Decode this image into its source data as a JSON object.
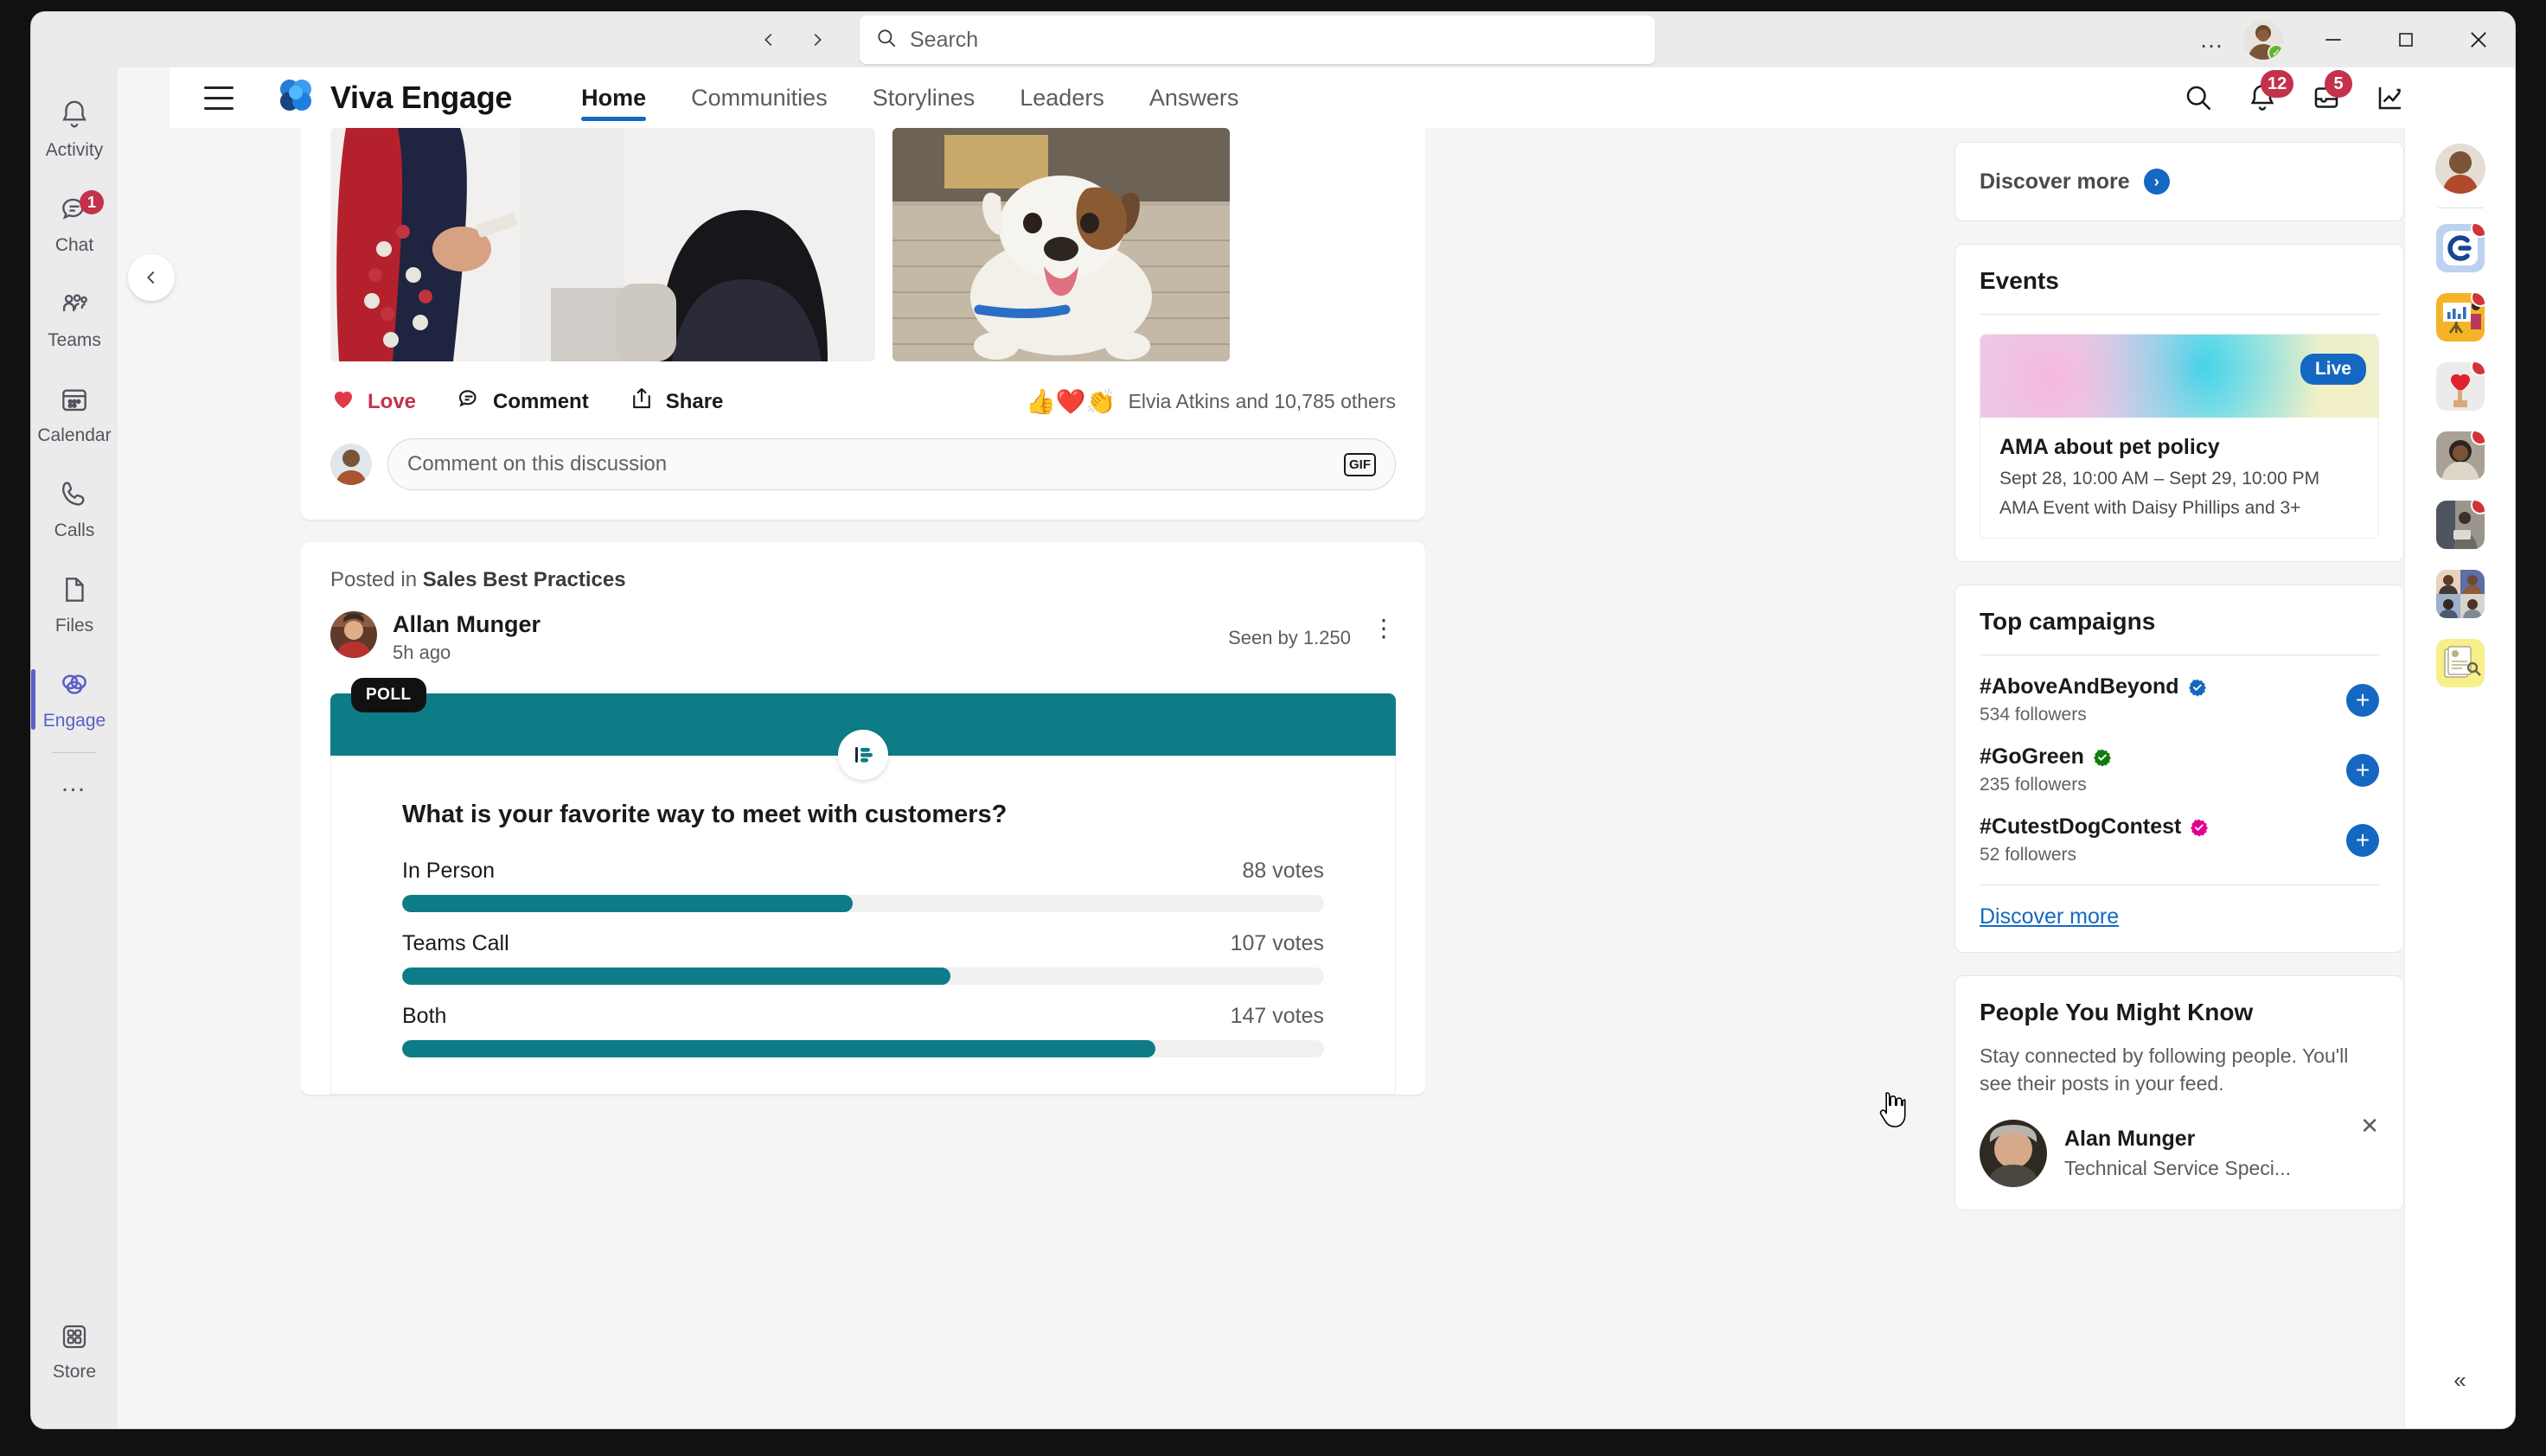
{
  "titlebar": {
    "back_icon": "chevron-left-icon",
    "forward_icon": "chevron-right-icon",
    "search_placeholder": "Search",
    "search_value": "",
    "more_label": "…",
    "minimize_label": "—",
    "maximize_label": "□",
    "close_label": "✕",
    "presence": "available"
  },
  "left_rail": {
    "items": [
      {
        "label": "Activity",
        "icon": "bell-icon",
        "badge": ""
      },
      {
        "label": "Chat",
        "icon": "chat-icon",
        "badge": "1"
      },
      {
        "label": "Teams",
        "icon": "teams-icon",
        "badge": ""
      },
      {
        "label": "Calendar",
        "icon": "calendar-icon",
        "badge": ""
      },
      {
        "label": "Calls",
        "icon": "phone-icon",
        "badge": ""
      },
      {
        "label": "Files",
        "icon": "file-icon",
        "badge": ""
      },
      {
        "label": "Engage",
        "icon": "engage-icon",
        "badge": ""
      }
    ],
    "more_label": "…",
    "store_label": "Store"
  },
  "app_header": {
    "menu_icon": "hamburger-icon",
    "brand": "Viva Engage",
    "tabs": [
      {
        "label": "Home",
        "active": true
      },
      {
        "label": "Communities",
        "active": false
      },
      {
        "label": "Storylines",
        "active": false
      },
      {
        "label": "Leaders",
        "active": false
      },
      {
        "label": "Answers",
        "active": false
      }
    ],
    "icons": [
      {
        "name": "search-icon",
        "badge": ""
      },
      {
        "name": "bell-icon",
        "badge": "12"
      },
      {
        "name": "inbox-icon",
        "badge": "5"
      },
      {
        "name": "analytics-icon",
        "badge": ""
      },
      {
        "name": "more-icon",
        "badge": ""
      }
    ]
  },
  "collapse_button": {
    "icon": "chevron-left-icon"
  },
  "feed": {
    "post1": {
      "actions": [
        {
          "label": "Love",
          "icon": "heart-icon",
          "active": true
        },
        {
          "label": "Comment",
          "icon": "comment-icon",
          "active": false
        },
        {
          "label": "Share",
          "icon": "share-icon",
          "active": false
        }
      ],
      "reaction_emojis": "👍❤️👏",
      "reaction_text": "Elvia Atkins and 10,785 others",
      "comment_placeholder": "Comment on this discussion",
      "gif_label": "GIF"
    },
    "post2": {
      "posted_in_prefix": "Posted in ",
      "community": "Sales Best Practices",
      "author": "Allan Munger",
      "time": "5h ago",
      "seen_by": "Seen by 1.250",
      "kebab_label": "⋮",
      "poll_badge": "POLL",
      "poll_icon": "poll-icon"
    }
  },
  "chart_data": {
    "type": "bar",
    "title": "What is your favorite way to meet with customers?",
    "categories": [
      "In Person",
      "Teams Call",
      "Both"
    ],
    "values": [
      88,
      107,
      147
    ],
    "value_labels": [
      "88 votes",
      "107 votes",
      "147 votes"
    ],
    "max": 180,
    "xlabel": "",
    "ylabel": "votes",
    "orientation": "horizontal",
    "grid": false,
    "legend": "none",
    "bar_color": "#0e7c86",
    "track_color": "#f0f0f0"
  },
  "right_column": {
    "discover_top": {
      "label": "Discover more",
      "icon": "chevron-right-circle-icon"
    },
    "events": {
      "title": "Events",
      "live_badge": "Live",
      "event_title": "AMA about pet policy",
      "event_date": "Sept 28, 10:00 AM – Sept 29, 10:00 PM",
      "event_detail": "AMA Event with Daisy Phillips and 3+"
    },
    "campaigns": {
      "title": "Top campaigns",
      "items": [
        {
          "name": "#AboveAndBeyond",
          "followers": "534 followers",
          "badge_color": "#1568c1",
          "add_label": "+"
        },
        {
          "name": "#GoGreen",
          "followers": "235 followers",
          "badge_color": "#107c10",
          "add_label": "+"
        },
        {
          "name": "#CutestDogContest",
          "followers": "52 followers",
          "badge_color": "#e3008c",
          "add_label": "+"
        }
      ],
      "discover_link": "Discover more"
    },
    "pymk": {
      "title": "People You Might Know",
      "subtitle": "Stay connected by following people. You'll see their posts in your feed.",
      "person_name": "Alan Munger",
      "person_role": "Technical Service Speci...",
      "close_label": "✕"
    }
  },
  "app_rail": {
    "icons": [
      {
        "name": "company-c-icon",
        "badge": true
      },
      {
        "name": "presentation-icon",
        "badge": true
      },
      {
        "name": "heart-hand-icon",
        "badge": true
      },
      {
        "name": "person-photo-icon",
        "badge": true
      },
      {
        "name": "people-laptop-icon",
        "badge": true
      },
      {
        "name": "people-grid-icon",
        "badge": false
      },
      {
        "name": "documents-icon",
        "badge": false
      }
    ],
    "collapse_label": "«"
  },
  "colors": {
    "accent_blue": "#1568c1",
    "teams_purple": "#5b5fc7",
    "badge_red": "#c4314b",
    "poll_teal": "#0e7c86"
  }
}
